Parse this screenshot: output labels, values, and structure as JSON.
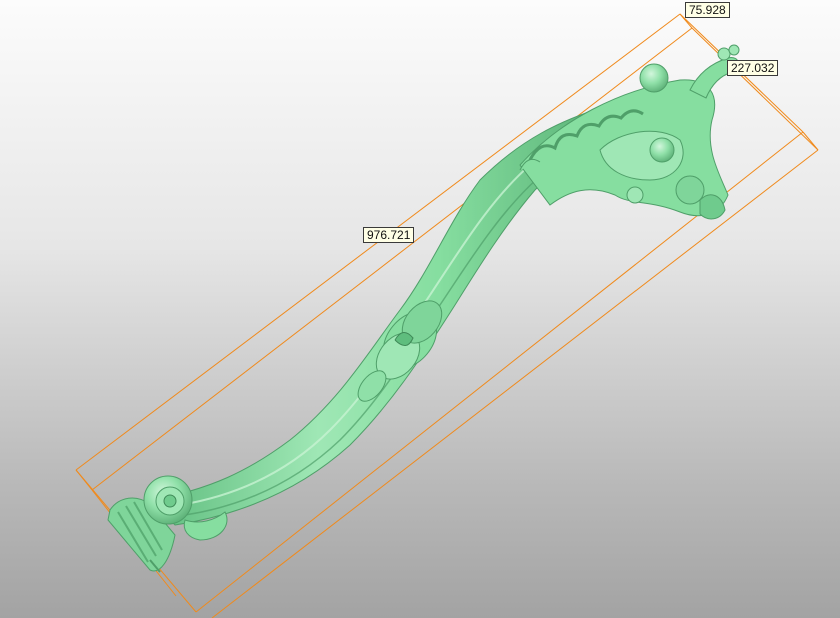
{
  "viewport": {
    "background_top": "#fcfcfc",
    "background_bottom": "#a3a3a3"
  },
  "model": {
    "color": "#86dea0",
    "shade_color": "#5fbd7e",
    "highlight_color": "#c7f3d2"
  },
  "bounding_box": {
    "line_color": "#f08a1c"
  },
  "dimensions": {
    "width": "75.928",
    "depth": "227.032",
    "length": "976.721"
  }
}
